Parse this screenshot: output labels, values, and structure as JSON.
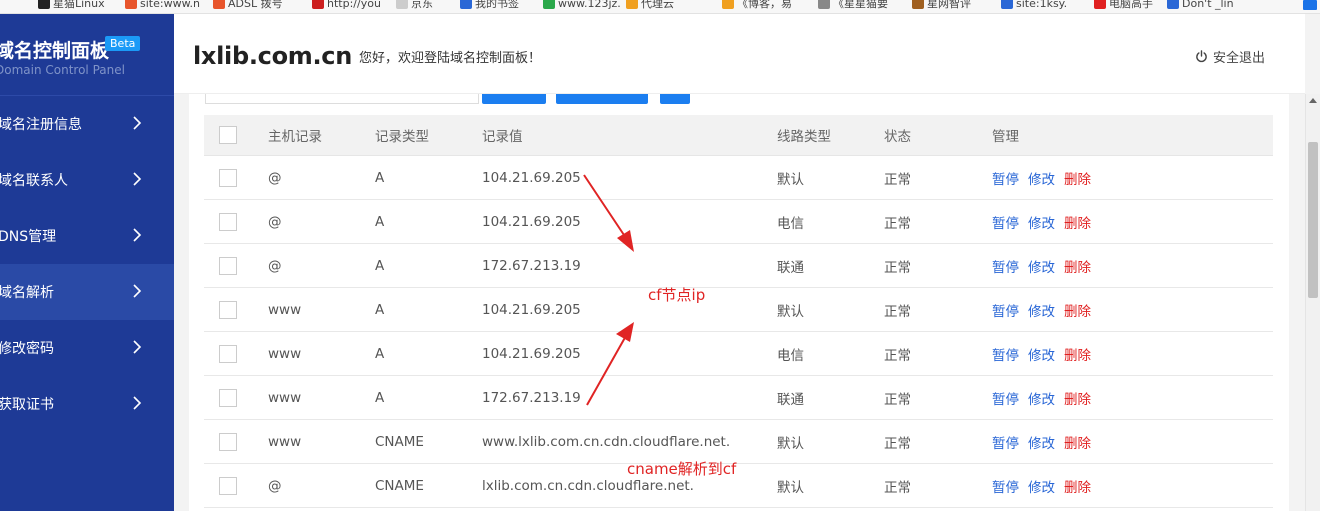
{
  "bookmarks": [
    {
      "label": "星猫Linux",
      "color": "#222222"
    },
    {
      "label": "site:www.n",
      "color": "#e8552c"
    },
    {
      "label": "ADSL 拨号",
      "color": "#e8552c"
    },
    {
      "label": "http://you",
      "color": "#cc1f1f"
    },
    {
      "label": "京东",
      "color": "#cccccc"
    },
    {
      "label": "我的书签",
      "color": "#2a67d6"
    },
    {
      "label": "www.123jz.",
      "color": "#2aa84a"
    },
    {
      "label": "代理云",
      "color": "#f0a020"
    },
    {
      "label": "《博客，易",
      "color": "#f0a020"
    },
    {
      "label": "《星星猫要",
      "color": "#888888"
    },
    {
      "label": "星网智评",
      "color": "#a06020"
    },
    {
      "label": "site:1ksy.",
      "color": "#2a67d6"
    },
    {
      "label": "电脑高手",
      "color": "#e02020"
    },
    {
      "label": "Don't _lin",
      "color": "#2a67d6"
    }
  ],
  "sidebar": {
    "brand_title": "域名控制面板",
    "beta": "Beta",
    "brand_sub": "Domain Control Panel",
    "items": [
      {
        "label": "域名注册信息",
        "active": false
      },
      {
        "label": "域名联系人",
        "active": false
      },
      {
        "label": "DNS管理",
        "active": false
      },
      {
        "label": "域名解析",
        "active": true
      },
      {
        "label": "修改密码",
        "active": false
      },
      {
        "label": "获取证书",
        "active": false
      }
    ]
  },
  "header": {
    "domain": "lxlib.com.cn",
    "welcome": "您好，欢迎登陆域名控制面板！",
    "logout": "安全退出"
  },
  "table": {
    "headers": {
      "host": "主机记录",
      "type": "记录类型",
      "value": "记录值",
      "line": "线路类型",
      "status": "状态",
      "manage": "管理"
    },
    "actions": {
      "pause": "暂停",
      "edit": "修改",
      "delete": "删除"
    },
    "rows": [
      {
        "host": "@",
        "type": "A",
        "value": "104.21.69.205",
        "line": "默认",
        "status": "正常"
      },
      {
        "host": "@",
        "type": "A",
        "value": "104.21.69.205",
        "line": "电信",
        "status": "正常"
      },
      {
        "host": "@",
        "type": "A",
        "value": "172.67.213.19",
        "line": "联通",
        "status": "正常"
      },
      {
        "host": "www",
        "type": "A",
        "value": "104.21.69.205",
        "line": "默认",
        "status": "正常"
      },
      {
        "host": "www",
        "type": "A",
        "value": "104.21.69.205",
        "line": "电信",
        "status": "正常"
      },
      {
        "host": "www",
        "type": "A",
        "value": "172.67.213.19",
        "line": "联通",
        "status": "正常"
      },
      {
        "host": "www",
        "type": "CNAME",
        "value": "www.lxlib.com.cn.cdn.cloudflare.net.",
        "line": "默认",
        "status": "正常"
      },
      {
        "host": "@",
        "type": "CNAME",
        "value": "lxlib.com.cn.cdn.cloudflare.net.",
        "line": "默认",
        "status": "正常"
      }
    ]
  },
  "annotations": {
    "cf_ip": "cf节点ip",
    "cname": "cname解析到cf"
  },
  "colors": {
    "sidebar": "#1e3a96",
    "accent": "#1b7ef0",
    "link": "#2a67d6",
    "danger": "#e02020",
    "annotation": "#e02424"
  }
}
